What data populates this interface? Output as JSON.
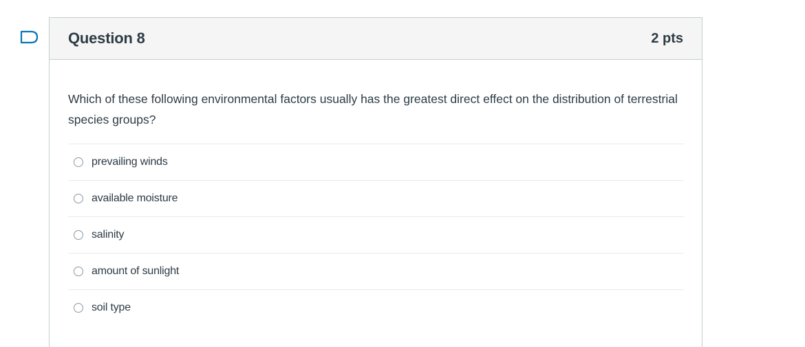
{
  "question": {
    "title": "Question 8",
    "points": "2 pts",
    "text": "Which of these following environmental factors usually has the greatest direct effect on the distribution of terrestrial species groups?",
    "flag_icon": "flag-outline-icon",
    "answers": [
      {
        "label": "prevailing winds",
        "selected": false
      },
      {
        "label": "available moisture",
        "selected": false
      },
      {
        "label": "salinity",
        "selected": false
      },
      {
        "label": "amount of sunlight",
        "selected": false
      },
      {
        "label": "soil type",
        "selected": false
      }
    ]
  },
  "colors": {
    "accent": "#0374b5",
    "text": "#2d3b45",
    "header_bg": "#f5f5f5",
    "border": "#c7cdd1"
  }
}
